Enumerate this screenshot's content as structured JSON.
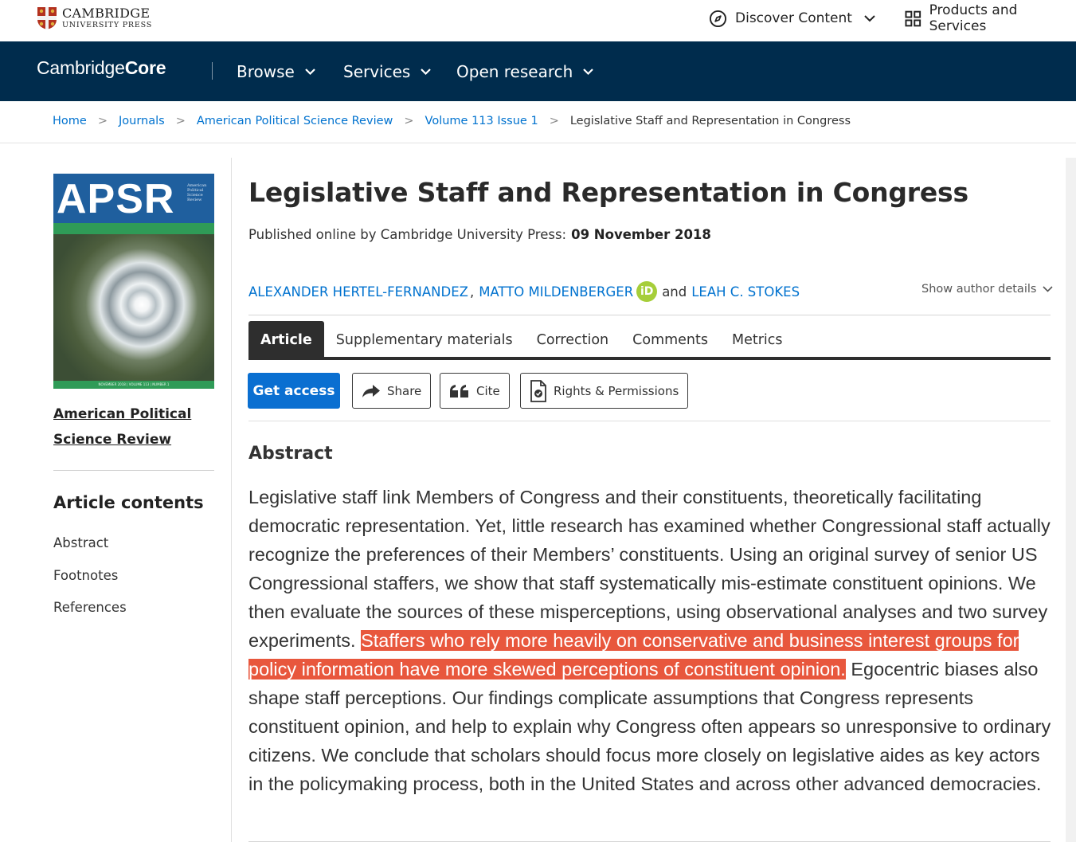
{
  "header": {
    "logo_line1": "CAMBRIDGE",
    "logo_line2": "UNIVERSITY PRESS",
    "discover_label": "Discover Content",
    "products_label": "Products and Services"
  },
  "core_nav": {
    "logo_regular": "Cambridge",
    "logo_bold": "Core",
    "items": [
      {
        "label": "Browse"
      },
      {
        "label": "Services"
      },
      {
        "label": "Open research"
      }
    ],
    "background": "#002c4d"
  },
  "breadcrumb": [
    {
      "label": "Home"
    },
    {
      "label": "Journals"
    },
    {
      "label": "American Political Science Review"
    },
    {
      "label": "Volume 113 Issue 1"
    },
    {
      "label": "Legislative Staff and Representation in Congress"
    }
  ],
  "sidebar": {
    "cover_title": "APSR",
    "cover_subtitle": "American Political Science Review",
    "cover_footer": "NOVEMBER 2018 | VOLUME 113 | NUMBER 1",
    "journal_line1": "American Political",
    "journal_line2": "Science Review",
    "contents_title": "Article contents",
    "contents_items": [
      {
        "label": "Abstract"
      },
      {
        "label": "Footnotes"
      },
      {
        "label": "References"
      }
    ]
  },
  "article": {
    "title": "Legislative Staff and Representation in Congress",
    "published_prefix": "Published online by Cambridge University Press:",
    "published_date": "09 November 2018",
    "authors": [
      {
        "name": "ALEXANDER HERTEL-FERNANDEZ"
      },
      {
        "name": "MATTO MILDENBERGER"
      },
      {
        "name": "LEAH C. STOKES"
      }
    ],
    "author_sep": ",",
    "author_and": "and",
    "orcid_label": "iD",
    "show_author_details": "Show author details"
  },
  "tabs": [
    {
      "label": "Article",
      "active": true
    },
    {
      "label": "Supplementary materials"
    },
    {
      "label": "Correction"
    },
    {
      "label": "Comments"
    },
    {
      "label": "Metrics"
    }
  ],
  "actions": {
    "get_access": "Get access",
    "share": "Share",
    "cite": "Cite",
    "rights": "Rights & Permissions"
  },
  "abstract": {
    "heading": "Abstract",
    "text_before": "Legislative staff link Members of Congress and their constituents, theoretically facilitating democratic representation. Yet, little research has examined whether Congressional staff actually recognize the preferences of their Members’ constituents. Using an original survey of senior US Congressional staffers, we show that staff systematically mis-estimate constituent opinions. We then evaluate the sources of these misperceptions, using observational analyses and two survey experiments. ",
    "text_highlighted": "Staffers who rely more heavily on conservative and business interest groups for policy information have more skewed perceptions of constituent opinion.",
    "text_after": " Egocentric biases also shape staff perceptions. Our findings complicate assumptions that Congress represents constituent opinion, and help to explain why Congress often appears so unresponsive to ordinary citizens. We conclude that scholars should focus more closely on legislative aides as key actors in the policymaking process, both in the United States and across other advanced democracies.",
    "highlight_color": "#e8573d"
  },
  "colors": {
    "link": "#0072cf",
    "primary_button": "#0a6fd1",
    "orcid": "#a6ce39"
  }
}
